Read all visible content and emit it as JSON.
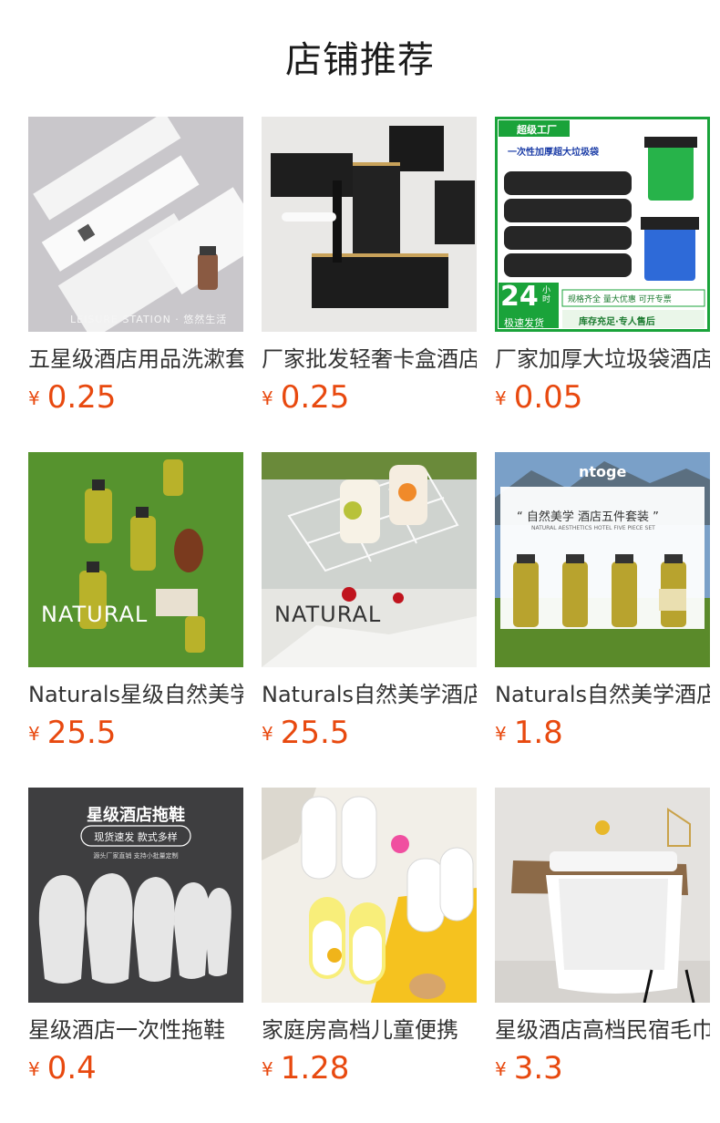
{
  "page": {
    "title": "店铺推荐"
  },
  "currency": "¥",
  "products": [
    {
      "name": "五星级酒店用品洗漱套装",
      "price": "0.25",
      "image": "white-toiletry-packets",
      "overlay": [
        "LEISURE STATION · 悠然生活"
      ]
    },
    {
      "name": "厂家批发轻奢卡盒酒店",
      "price": "0.25",
      "image": "black-gold-amenity-boxes",
      "overlay": []
    },
    {
      "name": "厂家加厚大垃圾袋酒店",
      "price": "0.05",
      "image": "garbage-bags-ad",
      "overlay": [
        "超级工厂",
        "一次性加厚超大垃圾袋",
        "24",
        "小时",
        "极速发货",
        "规格齐全 量大优惠 可开专票",
        "库存充足·专人售后"
      ]
    },
    {
      "name": "Naturals星级自然美学",
      "price": "25.5",
      "image": "bottles-on-grass",
      "overlay": [
        "NATURAL"
      ]
    },
    {
      "name": "Naturals自然美学酒店",
      "price": "25.5",
      "image": "bottles-in-basket",
      "overlay": [
        "NATURAL"
      ]
    },
    {
      "name": "Naturals自然美学酒店",
      "price": "1.8",
      "image": "five-piece-set-mountain",
      "overlay": [
        "ntoge",
        "“ 自然美学  酒店五件套装 ”",
        "NATURAL AESTHETICS HOTEL FIVE PIECE SET"
      ]
    },
    {
      "name": "星级酒店一次性拖鞋",
      "price": "0.4",
      "image": "white-slippers-dark",
      "overlay": [
        "星级酒店拖鞋",
        "现货速发  款式多样",
        "源头厂家直销 支持小批量定制"
      ]
    },
    {
      "name": "家庭房高档儿童便携",
      "price": "1.28",
      "image": "kids-slippers",
      "overlay": []
    },
    {
      "name": "星级酒店高档民宿毛巾",
      "price": "3.3",
      "image": "white-towels",
      "overlay": []
    }
  ],
  "colors": {
    "price": "#e8490f",
    "green": "#1aa33a"
  }
}
